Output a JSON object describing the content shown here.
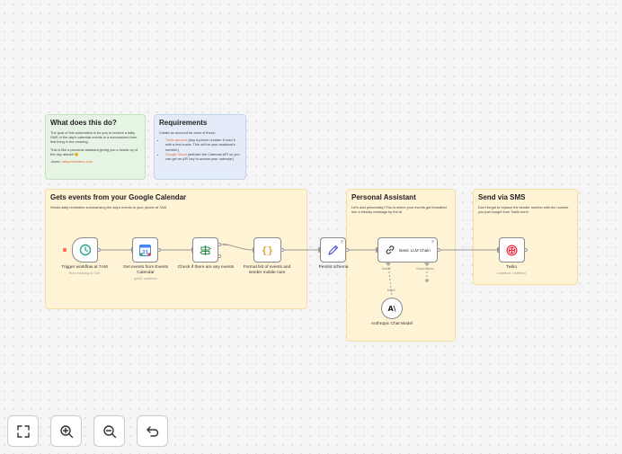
{
  "notes": {
    "what": {
      "title": "What does this do?",
      "p1": "The goal of this automation is for you to receive a daily SMS of the day's calendar events in a summarized form first thing in the morning.",
      "p2": "This is like a personal assistant giving you a heads up of the day ahead! 😊",
      "signature": "-Anne,",
      "signature_link": "rafeyreminders.com"
    },
    "requirements": {
      "title": "Requirements",
      "intro": "Create an account for each of these:",
      "twilio_link": "Twilio account",
      "twilio_text": "(buy a phone number & load it with a few bucks. This will be your assistant's number.)",
      "google_link": "Google Cloud",
      "google_text": "(activate the Calendar API so you can get an API key to access your calendar)"
    },
    "events": {
      "title": "Gets events from your Google Calendar",
      "desc": "Sends daily reminders summarizing the day's events to your phone at 7AM"
    },
    "assistant": {
      "title": "Personal Assistant",
      "desc": "Let's add personality! This is where your events get formatted into a friendly message by the AI."
    },
    "sms": {
      "title": "Send via SMS",
      "desc": "Don't forget to replace the sender number with the number you just bought from Twilio here!"
    }
  },
  "nodes": {
    "trigger": {
      "label": "Trigger workflow at 7AM",
      "sub": "Runs everyday at 7AM",
      "icon": "clock-icon"
    },
    "calendar": {
      "label": "Get events from Events Calendar",
      "sub": "getAll: undefined",
      "icon": "google-calendar-icon"
    },
    "check": {
      "label": "Check if there are any events",
      "branch_label": "true",
      "icon": "signpost-icon"
    },
    "format": {
      "label": "Format list of events and sender mobile num",
      "icon": "code-braces-icon"
    },
    "persist": {
      "label": "Persist schema",
      "icon": "pencil-icon"
    },
    "llm": {
      "label": "Basic LLM Chain",
      "model_port": "Model*",
      "parser_port": "Output Parser",
      "icon": "chain-link-icon"
    },
    "anthropic": {
      "label": "Anthropic Chat Model",
      "edge_label": "Model",
      "icon": "anthropic-logo-icon"
    },
    "twilio": {
      "label": "Twilio",
      "sub": "undefined: undefined",
      "icon": "twilio-logo-icon"
    }
  },
  "controls": {
    "fit": "fit-view-icon",
    "zoom_in": "zoom-in-icon",
    "zoom_out": "zoom-out-icon",
    "undo": "undo-icon"
  },
  "colors": {
    "accent": "#e8693d",
    "trigger_teal": "#2aa68a",
    "check_green": "#2f8f4e",
    "format_orange": "#e8a33a",
    "pencil_blue": "#4a5bd9",
    "twilio_red": "#f22f46"
  }
}
